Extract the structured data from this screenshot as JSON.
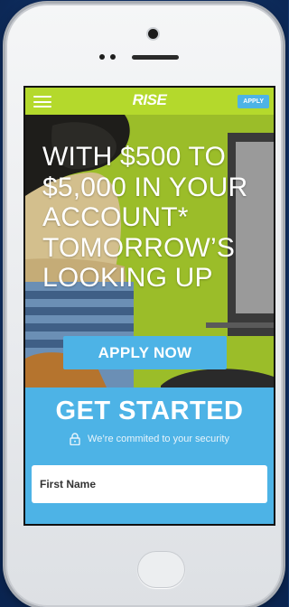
{
  "app": {
    "brand": "RISE"
  },
  "header": {
    "apply_label": "APPLY"
  },
  "hero": {
    "headline_lines": [
      "WITH $500 TO",
      "$5,000 IN YOUR",
      "ACCOUNT*",
      "TOMORROW’S",
      "LOOKING UP"
    ],
    "cta_label": "APPLY NOW"
  },
  "form": {
    "title": "GET STARTED",
    "security_note": "We’re commited to your security",
    "first_name_placeholder": "First Name"
  },
  "colors": {
    "accent_green": "#b4d92c",
    "accent_blue": "#4db3e6",
    "background": "#12356b"
  },
  "icons": [
    "hamburger-menu-icon",
    "lock-icon",
    "camera-icon",
    "speaker-icon",
    "home-button"
  ]
}
